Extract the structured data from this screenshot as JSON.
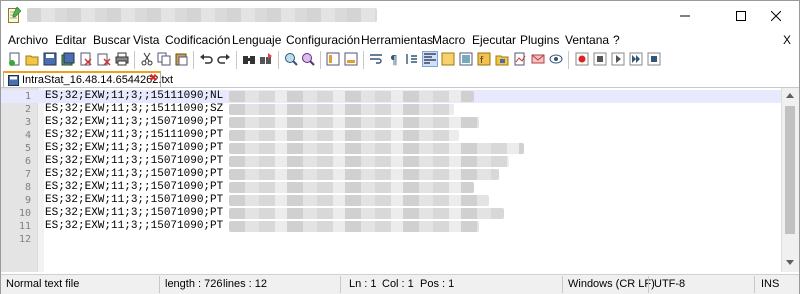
{
  "menu": {
    "items": [
      "Archivo",
      "Editar",
      "Buscar",
      "Vista",
      "Codificación",
      "Lenguaje",
      "Configuración",
      "Herramientas",
      "Macro",
      "Ejecutar",
      "Plugins",
      "Ventana",
      "?"
    ],
    "close_label": "X"
  },
  "tab": {
    "label": "IntraStat_16.48.14.6544262.txt",
    "close_glyph": "✖"
  },
  "editor": {
    "line_numbers": [
      "1",
      "2",
      "3",
      "4",
      "5",
      "6",
      "7",
      "8",
      "9",
      "10",
      "11",
      "12"
    ],
    "lines": [
      "ES;32;EXW;11;3;;15111090;NL",
      "ES;32;EXW;11;3;;15111090;SZ",
      "ES;32;EXW;11;3;;15071090;PT",
      "ES;32;EXW;11;3;;15111090;PT",
      "ES;32;EXW;11;3;;15071090;PT",
      "ES;32;EXW;11;3;;15071090;PT",
      "ES;32;EXW;11;3;;15071090;PT",
      "ES;32;EXW;11;3;;15071090;PT",
      "ES;32;EXW;11;3;;15071090;PT",
      "ES;32;EXW;11;3;;15071090;PT",
      "ES;32;EXW;11;3;;15071090;PT",
      ""
    ],
    "current_line_index": 0
  },
  "status": {
    "file_type": "Normal text file",
    "length": "length : 726",
    "lines": "lines : 12",
    "ln": "Ln : 1",
    "col": "Col : 1",
    "pos": "Pos : 1",
    "eol": "Windows (CR LF)",
    "encoding": "UTF-8",
    "mode": "INS"
  },
  "colors": {
    "current_line": "#e8e8ff",
    "tab_accent": "#f0a020",
    "gutter": "#e4e4e4"
  }
}
